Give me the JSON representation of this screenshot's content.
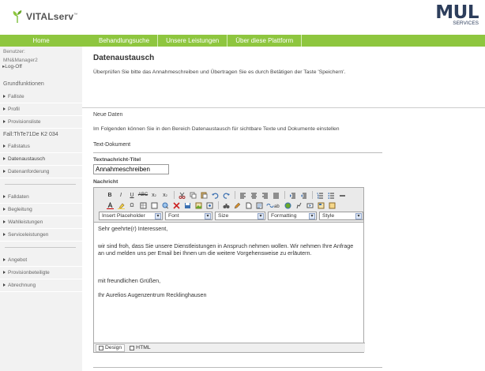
{
  "header": {
    "logo_text": "VITALserv",
    "logo_mark": "™",
    "partner_logo": "MUL",
    "partner_sub": "SERVICES"
  },
  "nav": {
    "home": "Home",
    "items": [
      "Behandlungsuche",
      "Unsere Leistungen",
      "Über diese Plattform"
    ]
  },
  "sidebar": {
    "user_label": "Benutzer:",
    "user_name": "MN&Manager2",
    "logoff": "▸Log-Off",
    "heading": "Grundfunktionen",
    "group1": [
      "Falliste",
      "Profil",
      "Provisionsliste"
    ],
    "case_label": "Fall:ThTe71De K2 034",
    "group2": [
      "Fallstatus",
      "Datenaustausch",
      "Datenanforderung"
    ],
    "group3": [
      "Falldaten",
      "Begleitung",
      "Wahlleistungen",
      "Serviceleistungen"
    ],
    "group4": [
      "Angebot",
      "Provisionbeteiligte",
      "Abrechnung"
    ]
  },
  "main": {
    "title": "Datenaustausch",
    "intro": "Überprüfen Sie bitte das Annahmeschreiben und Übertragen Sie es durch Betätigen der Taste 'Speichern'.",
    "section_title": "Neue Daten",
    "section_text": "Im Folgenden können Sie in den Bereich Datenaustausch für sichtbare Texte und Dokumente einstellen",
    "subsection": "Text-Dokument",
    "field_title_label": "Textnachricht-Titel",
    "field_title_value": "Annahmeschreiben",
    "message_label": "Nachricht"
  },
  "editor": {
    "dropdowns": [
      "Insert Placeholder",
      "Font",
      "Size",
      "Formatting",
      "Style"
    ],
    "content": {
      "greeting": "Sehr geehrte(r) Interessent,",
      "body": "wir sind froh, dass Sie unsere Dienstleistungen in Anspruch nehmen wollen. Wir nehmen Ihre Anfrage an und melden uns per Email bei Ihnen um die weitere Vorgehensweise zu erläutern.",
      "closing": "mit freundlichen Grüßen,",
      "signature": "Ihr Aurelios Augenzentrum Recklinghausen"
    },
    "modes": [
      "Design",
      "HTML"
    ]
  },
  "colors": {
    "nav_green": "#8ec63f",
    "sidebar_bg": "#f2f2f2",
    "partner_navy": "#2d3e5c"
  }
}
